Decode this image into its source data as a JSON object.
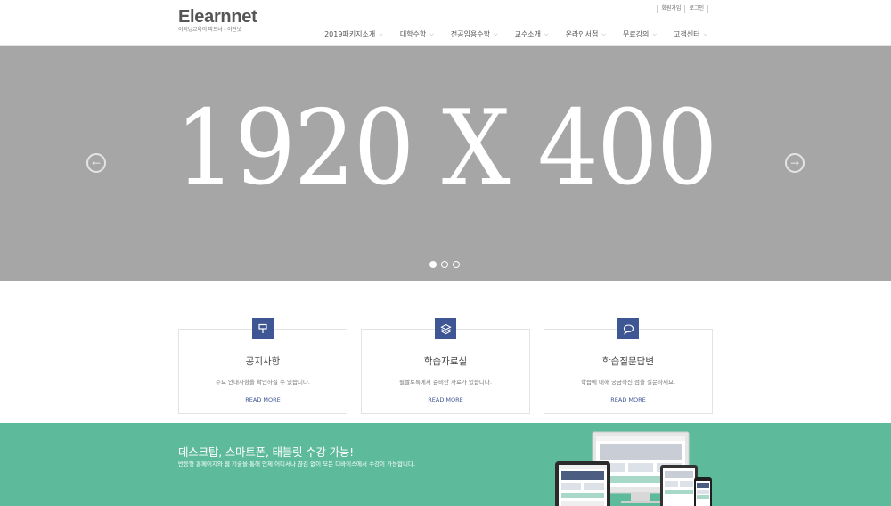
{
  "header": {
    "logo": "Elearnnet",
    "tagline": "이러닝교육의 파트너 - 이런넷",
    "top_links": [
      "회원가입",
      "로그인"
    ],
    "nav": [
      "2019패키지소개",
      "대학수학",
      "전공임용수학",
      "교수소개",
      "온라인서점",
      "무료강의",
      "고객센터"
    ]
  },
  "hero": {
    "text": "1920 X 400",
    "prev_icon": "arrow-left-icon",
    "next_icon": "arrow-right-icon",
    "slide_count": 3,
    "active_slide": 1
  },
  "cards": [
    {
      "icon": "signpost-icon",
      "title": "공지사항",
      "desc": "주요 안내사항을 확인하실 수 있습니다.",
      "link": "READ MORE"
    },
    {
      "icon": "layers-icon",
      "title": "학습자료실",
      "desc": "될빨토록에서 준비한 자료가 있습니다.",
      "link": "READ MORE"
    },
    {
      "icon": "speech-bubble-icon",
      "title": "학습질문답변",
      "desc": "학습에 대해 궁금하신 점을 질문하세요.",
      "link": "READ MORE"
    }
  ],
  "promo": {
    "title": "데스크탑, 스마트폰, 태블릿 수강 가능!",
    "desc": "반응형 홈페이지와 웹 기술을 통해 언제 어디서나 끊김 없이 모든 디바이스에서 수강이 가능합니다."
  },
  "colors": {
    "hero_bg": "#a6a6a6",
    "accent": "#3f5695",
    "promo_bg": "#5dbb9c"
  }
}
